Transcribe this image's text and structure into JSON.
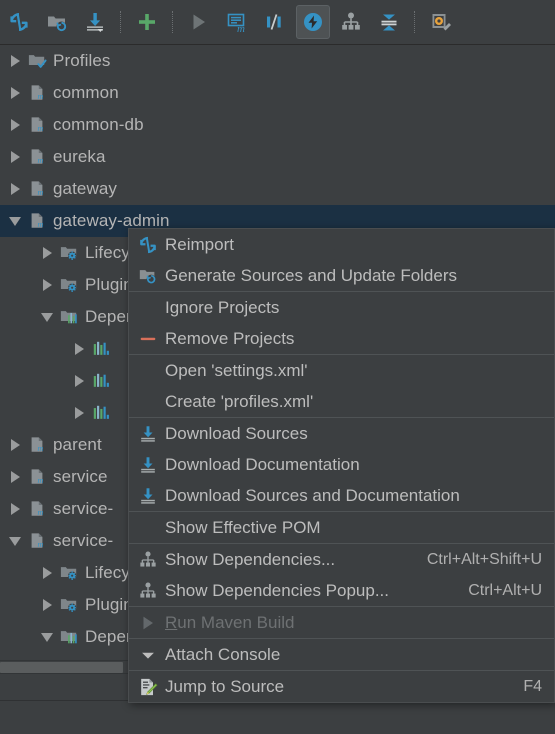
{
  "toolbar": {
    "items": [
      {
        "name": "reimport-all-maven-projects-icon",
        "icon": "refresh"
      },
      {
        "name": "generate-sources-and-update-folders-icon",
        "icon": "folder-refresh"
      },
      {
        "name": "download-sources-and-documentation-icon",
        "icon": "download"
      },
      {
        "name": "add-maven-projects-icon",
        "icon": "plus"
      },
      {
        "name": "run-maven-build-icon",
        "icon": "play"
      },
      {
        "name": "execute-maven-goal-icon",
        "icon": "maven-goal"
      },
      {
        "name": "toggle-skip-tests-icon",
        "icon": "skip-tests"
      },
      {
        "name": "toggle-offline-mode-icon",
        "icon": "offline"
      },
      {
        "name": "show-dependencies-icon",
        "icon": "dependencies"
      },
      {
        "name": "collapse-all-icon",
        "icon": "collapse-all"
      },
      {
        "name": "maven-settings-icon",
        "icon": "settings-gear"
      }
    ]
  },
  "tree": {
    "rows": [
      {
        "label": "Profiles",
        "indent": 0,
        "arrow": "right",
        "icon": "folder-check",
        "selected": false
      },
      {
        "label": "common",
        "indent": 0,
        "arrow": "right",
        "icon": "maven-module",
        "selected": false
      },
      {
        "label": "common-db",
        "indent": 0,
        "arrow": "right",
        "icon": "maven-module",
        "selected": false
      },
      {
        "label": "eureka",
        "indent": 0,
        "arrow": "right",
        "icon": "maven-module",
        "selected": false
      },
      {
        "label": "gateway",
        "indent": 0,
        "arrow": "right",
        "icon": "maven-module",
        "selected": false
      },
      {
        "label": "gateway-admin",
        "indent": 0,
        "arrow": "down",
        "icon": "maven-module",
        "selected": true
      },
      {
        "label": "Lifecycle",
        "indent": 1,
        "arrow": "right",
        "icon": "folder-gear",
        "selected": false
      },
      {
        "label": "Plugins",
        "indent": 1,
        "arrow": "right",
        "icon": "folder-gear",
        "selected": false
      },
      {
        "label": "Dependencies",
        "indent": 1,
        "arrow": "down",
        "icon": "folder-deps",
        "selected": false
      },
      {
        "label": "",
        "indent": 2,
        "arrow": "right",
        "icon": "dependency",
        "selected": false
      },
      {
        "label": "",
        "indent": 2,
        "arrow": "right",
        "icon": "dependency",
        "selected": false
      },
      {
        "label": "",
        "indent": 2,
        "arrow": "right",
        "icon": "dependency",
        "selected": false
      },
      {
        "label": "parent",
        "indent": 0,
        "arrow": "right",
        "icon": "maven-module",
        "selected": false
      },
      {
        "label": "service",
        "indent": 0,
        "arrow": "right",
        "icon": "maven-module",
        "selected": false
      },
      {
        "label": "service-",
        "indent": 0,
        "arrow": "right",
        "icon": "maven-module",
        "selected": false
      },
      {
        "label": "service-",
        "indent": 0,
        "arrow": "down",
        "icon": "maven-module",
        "selected": false
      },
      {
        "label": "Lifecycle",
        "indent": 1,
        "arrow": "right",
        "icon": "folder-gear",
        "selected": false
      },
      {
        "label": "Plugins",
        "indent": 1,
        "arrow": "right",
        "icon": "folder-gear",
        "selected": false
      },
      {
        "label": "Dependencies",
        "indent": 1,
        "arrow": "down",
        "icon": "folder-deps",
        "selected": false
      }
    ]
  },
  "context_menu": {
    "items": [
      {
        "label": "Reimport",
        "shortcut": "",
        "icon": "reimport-icon",
        "disabled": false,
        "separator_after": false
      },
      {
        "label": "Generate Sources and Update Folders",
        "shortcut": "",
        "icon": "folder-refresh-icon",
        "disabled": false,
        "separator_after": true
      },
      {
        "label": "Ignore Projects",
        "shortcut": "",
        "icon": "",
        "disabled": false,
        "separator_after": false
      },
      {
        "label": "Remove Projects",
        "shortcut": "",
        "icon": "minus-icon",
        "disabled": false,
        "separator_after": true
      },
      {
        "label": "Open 'settings.xml'",
        "shortcut": "",
        "icon": "",
        "disabled": false,
        "separator_after": false
      },
      {
        "label": "Create 'profiles.xml'",
        "shortcut": "",
        "icon": "",
        "disabled": false,
        "separator_after": true
      },
      {
        "label": "Download Sources",
        "shortcut": "",
        "icon": "download-icon",
        "disabled": false,
        "separator_after": false
      },
      {
        "label": "Download Documentation",
        "shortcut": "",
        "icon": "download-icon",
        "disabled": false,
        "separator_after": false
      },
      {
        "label": "Download Sources and Documentation",
        "shortcut": "",
        "icon": "download-icon",
        "disabled": false,
        "separator_after": true
      },
      {
        "label": "Show Effective POM",
        "shortcut": "",
        "icon": "",
        "disabled": false,
        "separator_after": true
      },
      {
        "label": "Show Dependencies...",
        "shortcut": "Ctrl+Alt+Shift+U",
        "icon": "dependencies-icon",
        "disabled": false,
        "separator_after": false
      },
      {
        "label": "Show Dependencies Popup...",
        "shortcut": "Ctrl+Alt+U",
        "icon": "dependencies-icon",
        "disabled": false,
        "separator_after": true
      },
      {
        "label": "Run Maven Build",
        "shortcut": "",
        "icon": "play-icon",
        "disabled": true,
        "separator_after": true,
        "mnemonic": 1
      },
      {
        "label": "Attach Console",
        "shortcut": "",
        "icon": "chevron-down-icon",
        "disabled": false,
        "separator_after": true
      },
      {
        "label": "Jump to Source",
        "shortcut": "F4",
        "icon": "jump-to-source-icon",
        "disabled": false,
        "separator_after": false
      }
    ]
  },
  "colors": {
    "background": "#3c3f41",
    "menu_background": "#3c3f41",
    "selection": "#1b3043",
    "accent_blue": "#3592c4",
    "accent_green": "#59a869",
    "text": "#bbbbbb",
    "text_disabled": "#6e7173",
    "separator": "#4f5355"
  }
}
